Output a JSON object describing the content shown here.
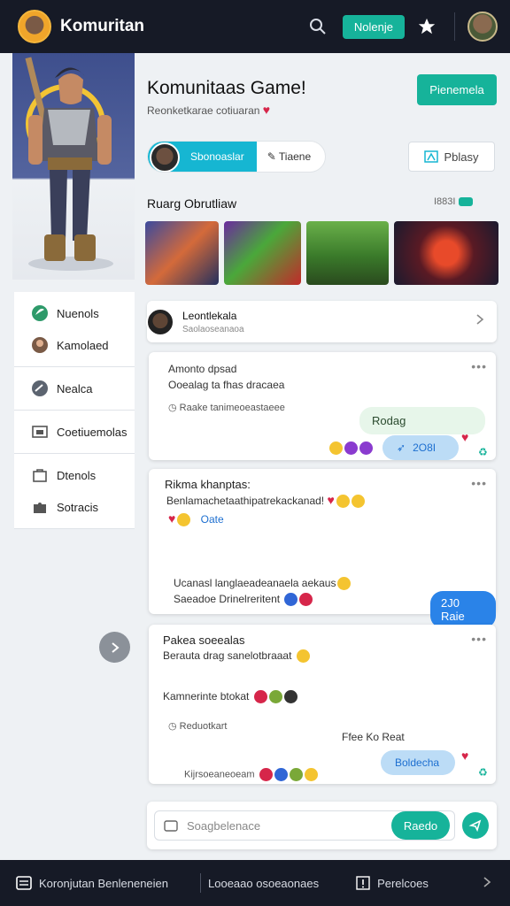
{
  "header": {
    "title": "Komuritan",
    "join_label": "Nolenje",
    "icons": [
      "search-icon",
      "star-icon"
    ]
  },
  "page": {
    "title": "Komunitaas Game!",
    "subtitle": "Reonketkarae cotiuaran",
    "cta_label": "Pienemela"
  },
  "tabs": {
    "active_label": "Sbonoaslar",
    "other_label": "Tiaene",
    "play_label": "Pblasy"
  },
  "gallery": {
    "title": "Ruarg Obrutliaw",
    "meta": "I883I"
  },
  "sidebar": {
    "items": [
      {
        "label": "Nuenols",
        "icon": "leaf-icon"
      },
      {
        "label": "Kamolaed",
        "icon": "user-avatar-icon"
      },
      {
        "label": "Nealca",
        "icon": "gauge-icon"
      },
      {
        "label": "Coetiuemolas",
        "icon": "image-icon"
      },
      {
        "label": "Dtenols",
        "icon": "bag-icon"
      },
      {
        "label": "Sotracis",
        "icon": "puzzle-icon"
      }
    ]
  },
  "notice": {
    "title": "Leontlekala",
    "subtitle": "Saolaoseanaoa"
  },
  "posts": [
    {
      "title": "Amonto dpsad",
      "line1": "Ooealag ta fhas dracaea",
      "meta": "Raake tanimeoeastaeee",
      "reply": "Rodag",
      "action": "2O8I"
    },
    {
      "title": "Rikma khanptas:",
      "line1": "Benlamachetaathipatrekackanad!",
      "reaction_label": "Oate",
      "line2": "Ucanasl langlaeadeanaela aekaus",
      "line3": "Saeadoe Drinelreritent",
      "action": "2J0 Raie"
    },
    {
      "title": "Pakea soeealas",
      "line1": "Berauta drag sanelotbraaat",
      "line2": "Kamnerinte btokat",
      "meta": "Reduotkart",
      "reply": "Ffee Ko Reat",
      "action": "Boldecha",
      "footer": "Kijrsoeaneoeam"
    }
  ],
  "composer": {
    "placeholder": "Soagbelenace",
    "send_label": "Raedo"
  },
  "bottom": {
    "left_label": "Koronjutan Benleneneien",
    "middle_label": "Looeaao osoeaonaes",
    "right_label": "Perelcoes"
  },
  "colors": {
    "brand": "#16b39a",
    "active_tab": "#16b6d2",
    "header_bg": "#161a26",
    "accent_blue": "#2a83e8"
  }
}
